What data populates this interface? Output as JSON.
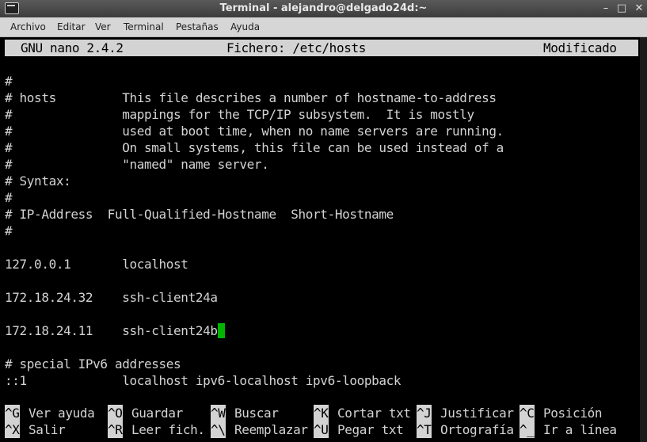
{
  "window": {
    "title": "Terminal - alejandro@delgado24d:~",
    "minimize": "–",
    "maximize": "□",
    "close": "✕"
  },
  "menubar": [
    "Archivo",
    "Editar",
    "Ver",
    "Terminal",
    "Pestañas",
    "Ayuda"
  ],
  "nano": {
    "version": "GNU nano 2.4.2",
    "file": "Fichero: /etc/hosts",
    "status": "Modificado"
  },
  "lines": [
    "",
    "#",
    "# hosts         This file describes a number of hostname-to-address",
    "#               mappings for the TCP/IP subsystem.  It is mostly",
    "#               used at boot time, when no name servers are running.",
    "#               On small systems, this file can be used instead of a",
    "#               \"named\" name server.",
    "# Syntax:",
    "#",
    "# IP-Address  Full-Qualified-Hostname  Short-Hostname",
    "#",
    "",
    "127.0.0.1       localhost",
    "",
    "172.18.24.32    ssh-client24a",
    "",
    "172.18.24.11    ssh-client24b",
    "",
    "# special IPv6 addresses",
    "::1             localhost ipv6-localhost ipv6-loopback"
  ],
  "shortcuts": [
    [
      {
        "key": "^G",
        "label": "Ver ayuda"
      },
      {
        "key": "^O",
        "label": "Guardar"
      },
      {
        "key": "^W",
        "label": "Buscar"
      },
      {
        "key": "^K",
        "label": "Cortar txt"
      },
      {
        "key": "^J",
        "label": "Justificar"
      },
      {
        "key": "^C",
        "label": "Posición"
      }
    ],
    [
      {
        "key": "^X",
        "label": "Salir"
      },
      {
        "key": "^R",
        "label": "Leer fich."
      },
      {
        "key": "^\\",
        "label": "Reemplazar"
      },
      {
        "key": "^U",
        "label": "Pegar txt"
      },
      {
        "key": "^T",
        "label": "Ortografía"
      },
      {
        "key": "^_",
        "label": "Ir a línea"
      }
    ]
  ]
}
